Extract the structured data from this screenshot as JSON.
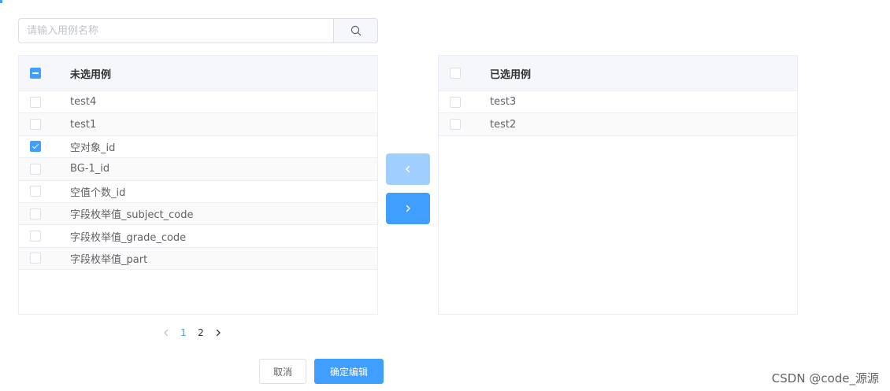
{
  "search": {
    "placeholder": "请输入用例名称",
    "value": "",
    "icon": "search-icon"
  },
  "left_table": {
    "header": "未选用例",
    "header_checkbox": "indeterminate",
    "rows": [
      {
        "label": "test4",
        "checked": false
      },
      {
        "label": "test1",
        "checked": false
      },
      {
        "label": "空对象_id",
        "checked": true
      },
      {
        "label": "BG-1_id",
        "checked": false
      },
      {
        "label": "空值个数_id",
        "checked": false
      },
      {
        "label": "字段枚举值_subject_code",
        "checked": false
      },
      {
        "label": "字段枚举值_grade_code",
        "checked": false
      },
      {
        "label": "字段枚举值_part",
        "checked": false
      }
    ]
  },
  "right_table": {
    "header": "已选用例",
    "header_checkbox": "unchecked",
    "rows": [
      {
        "label": "test3",
        "checked": false
      },
      {
        "label": "test2",
        "checked": false
      }
    ]
  },
  "transfer": {
    "to_left_icon": "chevron-left-icon",
    "to_right_icon": "chevron-right-icon",
    "to_left_disabled": true
  },
  "pagination": {
    "pages": [
      "1",
      "2"
    ],
    "current": "1",
    "prev_icon": "chevron-left-icon",
    "next_icon": "chevron-right-icon"
  },
  "footer": {
    "cancel_label": "取消",
    "confirm_label": "确定编辑"
  },
  "watermark": "CSDN @code_源源",
  "colors": {
    "primary": "#409eff",
    "primary_disabled": "#a0cfff",
    "border": "#dcdfe6",
    "header_bg": "#f5f7fa"
  }
}
